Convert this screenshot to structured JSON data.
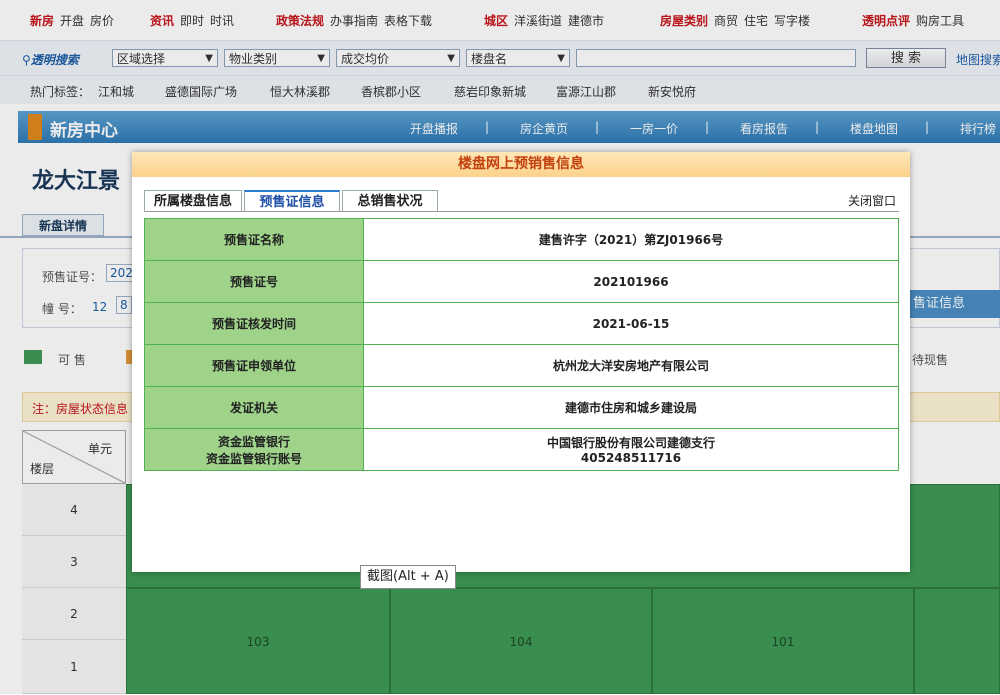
{
  "topnav": {
    "groups": [
      {
        "head": "新房",
        "items": [
          "开盘",
          "房价"
        ]
      },
      {
        "head": "资讯",
        "items": [
          "即时",
          "时讯"
        ]
      },
      {
        "head": "政策法规",
        "items": [
          "办事指南",
          "表格下载"
        ]
      },
      {
        "head": "城区",
        "items": [
          "洋溪街道",
          "建德市"
        ]
      },
      {
        "head": "房屋类别",
        "items": [
          "商贸",
          "住宅",
          "写字楼"
        ]
      },
      {
        "head": "透明点评",
        "items": [
          "购房工具"
        ]
      }
    ]
  },
  "search": {
    "logo": "透明搜索",
    "region_select": "区域选择",
    "property_select": "物业类别",
    "price_select": "成交均价",
    "name_select": "楼盘名",
    "button": "搜 索",
    "map_link": "地图搜索"
  },
  "tags": {
    "label": "热门标签：",
    "items": [
      "江和城",
      "盛德国际广场",
      "恒大林溪郡",
      "香槟郡小区",
      "慈岩印象新城",
      "富源江山郡",
      "新安悦府"
    ]
  },
  "banner": {
    "title": "新房中心",
    "links": [
      "开盘播报",
      "房企黄页",
      "一房一价",
      "看房报告",
      "楼盘地图",
      "排行榜"
    ],
    "separator": "|"
  },
  "background": {
    "page_title": "龙大江景",
    "tab_detail": "新盘详情",
    "presale_label": "预售证号：",
    "presale_value": "2021",
    "building_label": "幢 号：",
    "building_value": "12",
    "building_box": "8",
    "presale_info_button": "售证信息",
    "legend_sale": "可 售",
    "legend_current": "待现售",
    "note": "注：房屋状态信息",
    "grid_unit": "单元",
    "grid_floor": "楼层",
    "floors": [
      "4",
      "3",
      "2",
      "1"
    ],
    "units": [
      "103",
      "104",
      "101"
    ]
  },
  "modal": {
    "title": "楼盘网上预销售信息",
    "tabs": [
      "所属楼盘信息",
      "预售证信息",
      "总销售状况"
    ],
    "active_tab": 1,
    "close": "关闭窗口",
    "rows": [
      {
        "key": "预售证名称",
        "value": "建售许字（2021）第ZJ01966号"
      },
      {
        "key": "预售证号",
        "value": "202101966"
      },
      {
        "key": "预售证核发时间",
        "value": "2021-06-15"
      },
      {
        "key": "预售证申领单位",
        "value": "杭州龙大洋安房地产有限公司"
      },
      {
        "key": "发证机关",
        "value": "建德市住房和城乡建设局"
      },
      {
        "key": "资金监管银行",
        "key2": "资金监管银行账号",
        "value": "中国银行股份有限公司建德支行",
        "value2": "405248511716"
      }
    ]
  },
  "tooltip": "截图(Alt + A)",
  "colors": {
    "accent_red": "#c8161d",
    "banner_blue": "#2f7ab6",
    "grid_green": "#3e9a55",
    "modal_orange": "#c2410c",
    "key_green": "#9fd38a"
  }
}
